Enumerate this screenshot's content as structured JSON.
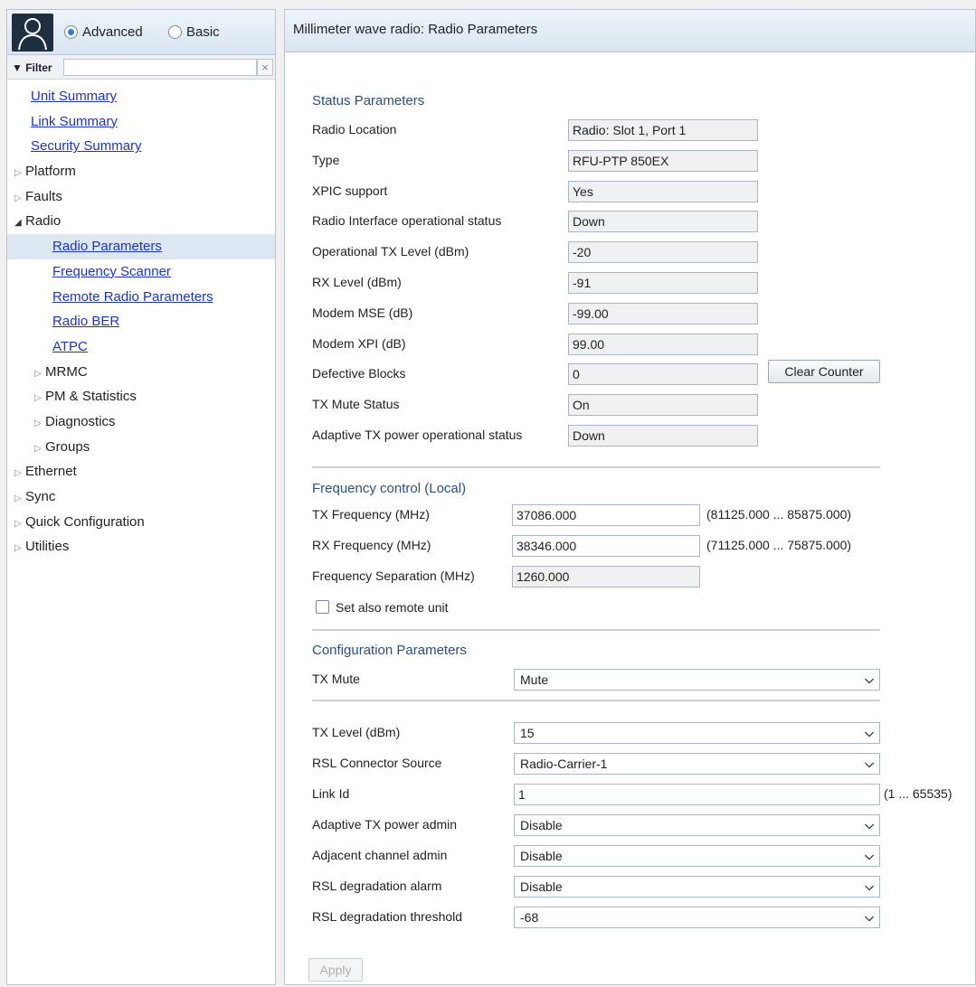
{
  "sidebar": {
    "mode_options": [
      {
        "label": "Advanced",
        "selected": true
      },
      {
        "label": "Basic",
        "selected": false
      }
    ],
    "filter_label": "▼ Filter",
    "filter_value": "",
    "filter_clear": "×",
    "nav": [
      {
        "label": "Unit Summary",
        "type": "link",
        "indent": 0
      },
      {
        "label": "Link Summary",
        "type": "link",
        "indent": 0
      },
      {
        "label": "Security Summary",
        "type": "link",
        "indent": 0
      },
      {
        "label": "Platform",
        "type": "collapsed",
        "indent": 0
      },
      {
        "label": "Faults",
        "type": "collapsed",
        "indent": 0
      },
      {
        "label": "Radio",
        "type": "expanded",
        "indent": 0
      },
      {
        "label": "Radio Parameters",
        "type": "link",
        "indent": 2,
        "selected": true
      },
      {
        "label": "Frequency Scanner",
        "type": "link",
        "indent": 2
      },
      {
        "label": "Remote Radio Parameters",
        "type": "link",
        "indent": 2
      },
      {
        "label": "Radio BER",
        "type": "link",
        "indent": 2
      },
      {
        "label": "ATPC",
        "type": "link",
        "indent": 2
      },
      {
        "label": "MRMC",
        "type": "collapsed",
        "indent": 1
      },
      {
        "label": "PM & Statistics",
        "type": "collapsed",
        "indent": 1
      },
      {
        "label": "Diagnostics",
        "type": "collapsed",
        "indent": 1
      },
      {
        "label": "Groups",
        "type": "collapsed",
        "indent": 1
      },
      {
        "label": "Ethernet",
        "type": "collapsed",
        "indent": 0
      },
      {
        "label": "Sync",
        "type": "collapsed",
        "indent": 0
      },
      {
        "label": "Quick Configuration",
        "type": "collapsed",
        "indent": 0
      },
      {
        "label": "Utilities",
        "type": "collapsed",
        "indent": 0
      }
    ]
  },
  "main": {
    "title": "Millimeter wave radio: Radio Parameters",
    "status": {
      "title": "Status Parameters",
      "rows": [
        {
          "label": "Radio Location",
          "value": "Radio: Slot 1, Port 1"
        },
        {
          "label": "Type",
          "value": "RFU-PTP 850EX"
        },
        {
          "label": "XPIC support",
          "value": "Yes"
        },
        {
          "label": "Radio Interface operational status",
          "value": "Down"
        },
        {
          "label": "Operational TX Level (dBm)",
          "value": "-20"
        },
        {
          "label": "RX Level (dBm)",
          "value": "-91"
        },
        {
          "label": "Modem MSE (dB)",
          "value": "-99.00"
        },
        {
          "label": "Modem XPI (dB)",
          "value": "99.00"
        },
        {
          "label": "Defective Blocks",
          "value": "0"
        },
        {
          "label": "TX Mute Status",
          "value": "On"
        },
        {
          "label": "Adaptive TX power operational status",
          "value": "Down"
        }
      ],
      "clear_counter_label": "Clear Counter"
    },
    "frequency": {
      "title": "Frequency control (Local)",
      "tx_label": "TX Frequency (MHz)",
      "tx_value": "37086.000",
      "tx_range": "(81125.000 ... 85875.000)",
      "rx_label": "RX Frequency (MHz)",
      "rx_value": "38346.000",
      "rx_range": "(71125.000 ... 75875.000)",
      "sep_label": "Frequency Separation (MHz)",
      "sep_value": "1260.000",
      "remote_label": "Set also remote unit",
      "remote_checked": false
    },
    "config": {
      "title": "Configuration Parameters",
      "tx_mute_label": "TX Mute",
      "tx_mute_value": "Mute",
      "tx_level_label": "TX Level (dBm)",
      "tx_level_value": "15",
      "rsl_source_label": "RSL Connector Source",
      "rsl_source_value": "Radio-Carrier-1",
      "link_id_label": "Link Id",
      "link_id_value": "1",
      "link_id_range": "(1 ... 65535)",
      "adaptive_label": "Adaptive TX power admin",
      "adaptive_value": "Disable",
      "adjacent_label": "Adjacent channel admin",
      "adjacent_value": "Disable",
      "rsl_alarm_label": "RSL degradation alarm",
      "rsl_alarm_value": "Disable",
      "rsl_threshold_label": "RSL degradation threshold",
      "rsl_threshold_value": "-68"
    },
    "apply_label": "Apply"
  }
}
